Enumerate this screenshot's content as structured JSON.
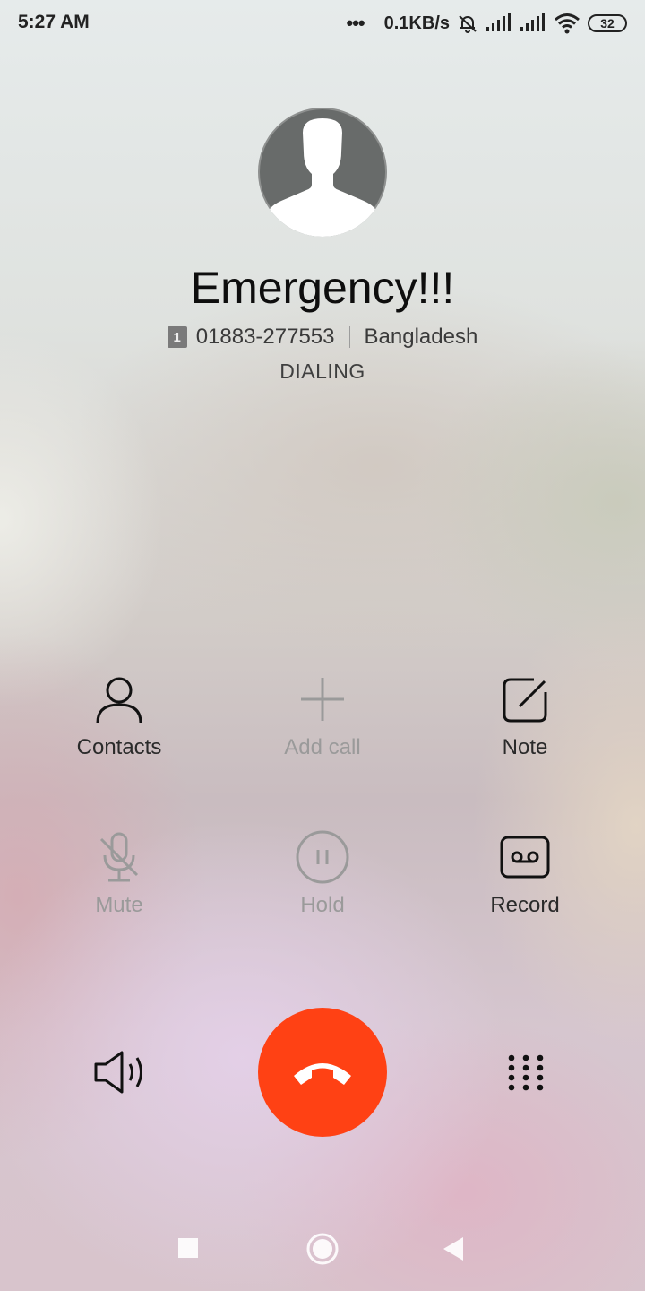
{
  "status_bar": {
    "time": "5:27 AM",
    "overflow": "•••",
    "net_speed": "0.1KB/s",
    "battery": "32",
    "icons": [
      "dots-icon",
      "bell-muted-icon",
      "signal-icon",
      "signal-icon",
      "wifi-icon",
      "battery-icon"
    ]
  },
  "caller": {
    "name": "Emergency!!!",
    "sim_slot": "1",
    "number": "01883-277553",
    "location": "Bangladesh",
    "status": "DIALING",
    "avatar_icon": "person-placeholder-icon"
  },
  "actions": {
    "contacts": {
      "label": "Contacts",
      "icon": "person-icon",
      "enabled": true
    },
    "add_call": {
      "label": "Add call",
      "icon": "plus-icon",
      "enabled": false
    },
    "note": {
      "label": "Note",
      "icon": "note-edit-icon",
      "enabled": true
    },
    "mute": {
      "label": "Mute",
      "icon": "mic-off-icon",
      "enabled": false
    },
    "hold": {
      "label": "Hold",
      "icon": "pause-icon",
      "enabled": false
    },
    "record": {
      "label": "Record",
      "icon": "tape-icon",
      "enabled": true
    }
  },
  "controls": {
    "speaker_icon": "speaker-icon",
    "end_call_icon": "hang-up-icon",
    "end_call_color": "#ff4114",
    "keypad_icon": "dialpad-icon"
  },
  "nav_bar": {
    "icons": [
      "recents-square-icon",
      "home-circle-icon",
      "back-triangle-icon"
    ]
  },
  "colors": {
    "text_primary": "#0e0e0e",
    "text_disabled": "#9a9a9a",
    "accent_end_call": "#ff4114"
  }
}
